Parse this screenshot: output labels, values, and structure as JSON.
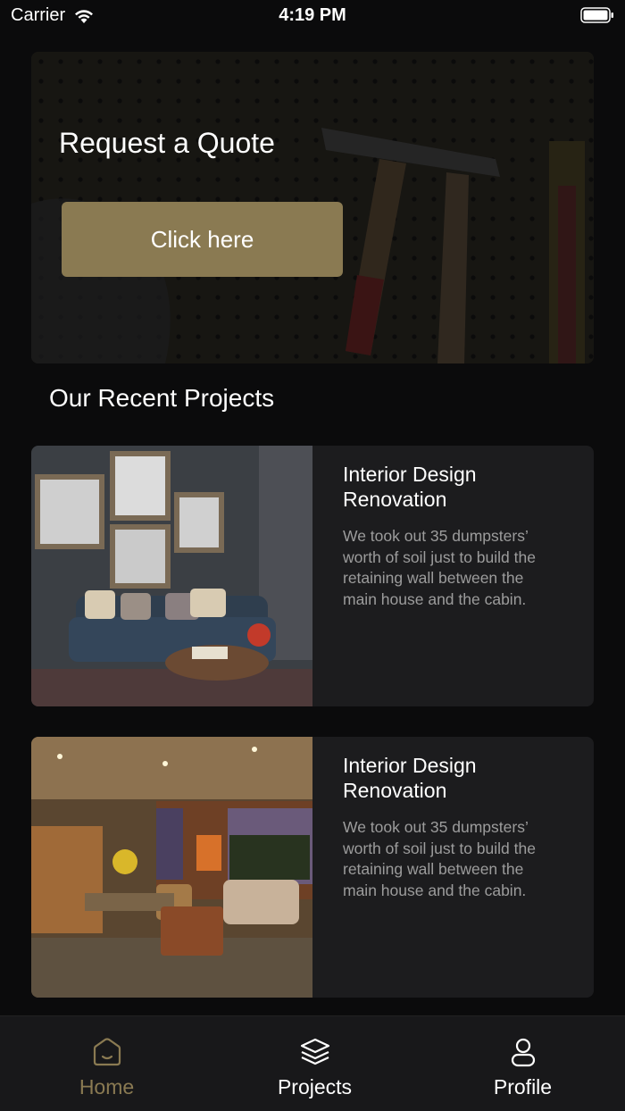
{
  "status_bar": {
    "carrier": "Carrier",
    "time": "4:19 PM"
  },
  "hero": {
    "title": "Request a Quote",
    "button_label": "Click here"
  },
  "section": {
    "title": "Our Recent Projects"
  },
  "projects": [
    {
      "title": "Interior Design Renovation",
      "description": "We took out 35 dumpsters’ worth of soil just to build the retaining wall between the main house and the cabin."
    },
    {
      "title": "Interior Design Renovation",
      "description": "We took out 35 dumpsters’ worth of soil just to build the retaining wall between the main house and the cabin."
    }
  ],
  "tabs": [
    {
      "label": "Home",
      "icon": "home-icon",
      "active": true
    },
    {
      "label": "Projects",
      "icon": "layers-icon",
      "active": false
    },
    {
      "label": "Profile",
      "icon": "person-icon",
      "active": false
    }
  ],
  "colors": {
    "accent": "#8a7a52",
    "background": "#0b0b0c",
    "card": "#1c1c1e",
    "muted_text": "#9c9c9c"
  }
}
